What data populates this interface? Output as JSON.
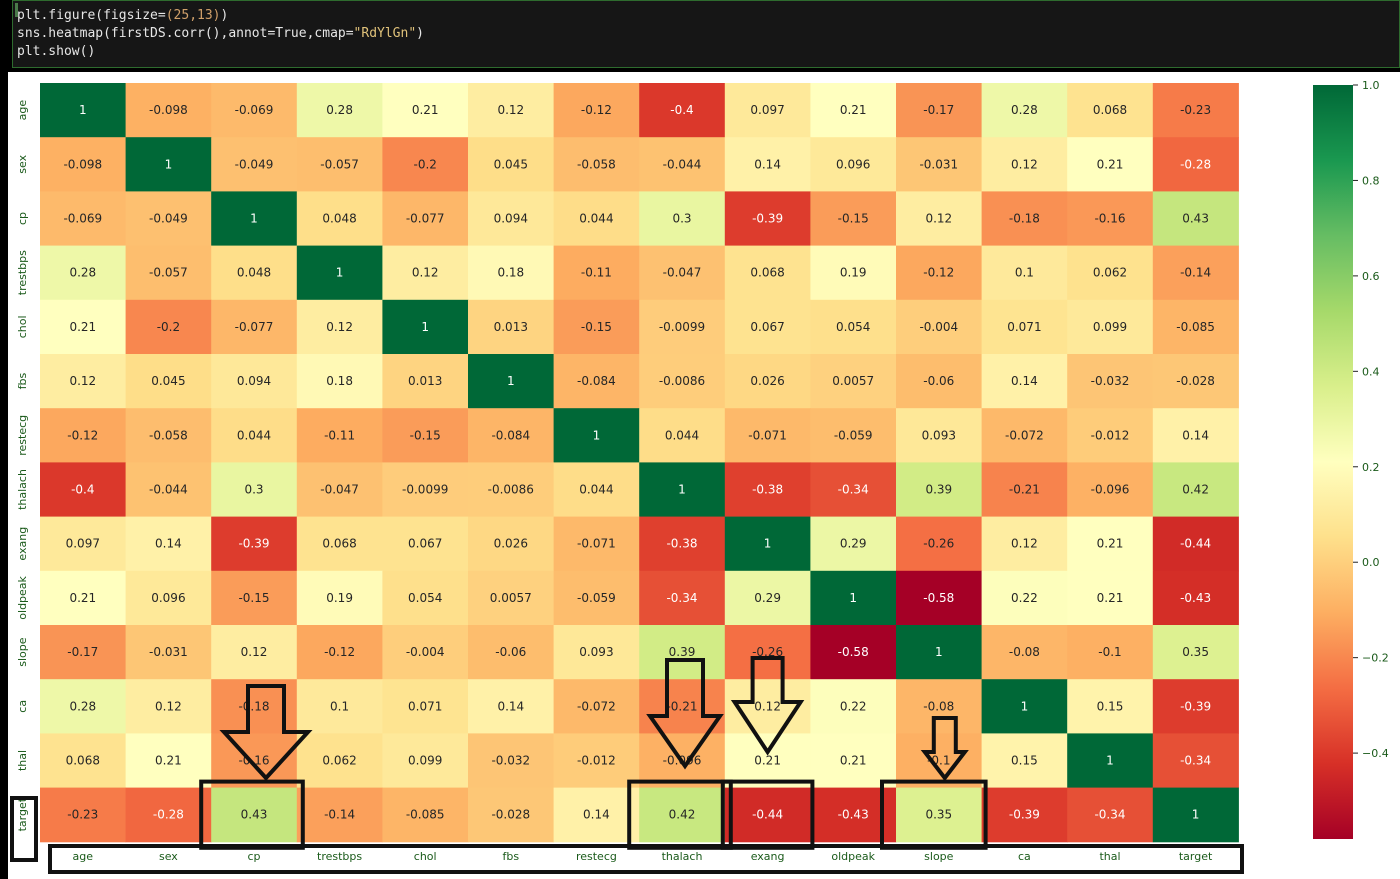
{
  "code": {
    "line1_pre": "plt.figure(figsize=",
    "line1_lit": "(25,13)",
    "line1_post": ")",
    "line2_pre": "sns.heatmap(firstDS.corr(),annot=True,cmap=",
    "line2_str": "\"RdYlGn\"",
    "line2_post": ")",
    "line3": "plt.show()"
  },
  "chart_data": {
    "type": "heatmap",
    "colormap": "RdYlGn",
    "vmin": -0.58,
    "vmax": 1.0,
    "rows": [
      "age",
      "sex",
      "cp",
      "trestbps",
      "chol",
      "fbs",
      "restecg",
      "thalach",
      "exang",
      "oldpeak",
      "slope",
      "ca",
      "thal",
      "target"
    ],
    "cols": [
      "age",
      "sex",
      "cp",
      "trestbps",
      "chol",
      "fbs",
      "restecg",
      "thalach",
      "exang",
      "oldpeak",
      "slope",
      "ca",
      "thal",
      "target"
    ],
    "values": [
      [
        1,
        -0.098,
        -0.069,
        0.28,
        0.21,
        0.12,
        -0.12,
        -0.4,
        0.097,
        0.21,
        -0.17,
        0.28,
        0.068,
        -0.23
      ],
      [
        -0.098,
        1,
        -0.049,
        -0.057,
        -0.2,
        0.045,
        -0.058,
        -0.044,
        0.14,
        0.096,
        -0.031,
        0.12,
        0.21,
        -0.28
      ],
      [
        -0.069,
        -0.049,
        1,
        0.048,
        -0.077,
        0.094,
        0.044,
        0.3,
        -0.39,
        -0.15,
        0.12,
        -0.18,
        -0.16,
        0.43
      ],
      [
        0.28,
        -0.057,
        0.048,
        1,
        0.12,
        0.18,
        -0.11,
        -0.047,
        0.068,
        0.19,
        -0.12,
        0.1,
        0.062,
        -0.14
      ],
      [
        0.21,
        -0.2,
        -0.077,
        0.12,
        1,
        0.013,
        -0.15,
        -0.0099,
        0.067,
        0.054,
        -0.004,
        0.071,
        0.099,
        -0.085
      ],
      [
        0.12,
        0.045,
        0.094,
        0.18,
        0.013,
        1,
        -0.084,
        -0.0086,
        0.026,
        0.0057,
        -0.06,
        0.14,
        -0.032,
        -0.028
      ],
      [
        -0.12,
        -0.058,
        0.044,
        -0.11,
        -0.15,
        -0.084,
        1,
        0.044,
        -0.071,
        -0.059,
        0.093,
        -0.072,
        -0.012,
        0.14
      ],
      [
        -0.4,
        -0.044,
        0.3,
        -0.047,
        -0.0099,
        -0.0086,
        0.044,
        1,
        -0.38,
        -0.34,
        0.39,
        -0.21,
        -0.096,
        0.42
      ],
      [
        0.097,
        0.14,
        -0.39,
        0.068,
        0.067,
        0.026,
        -0.071,
        -0.38,
        1,
        0.29,
        -0.26,
        0.12,
        0.21,
        -0.44
      ],
      [
        0.21,
        0.096,
        -0.15,
        0.19,
        0.054,
        0.0057,
        -0.059,
        -0.34,
        0.29,
        1,
        -0.58,
        0.22,
        0.21,
        -0.43
      ],
      [
        -0.17,
        -0.031,
        0.12,
        -0.12,
        -0.004,
        -0.06,
        0.093,
        0.39,
        -0.26,
        -0.58,
        1,
        -0.08,
        -0.1,
        0.35
      ],
      [
        0.28,
        0.12,
        -0.18,
        0.1,
        0.071,
        0.14,
        -0.072,
        -0.21,
        0.12,
        0.22,
        -0.08,
        1,
        0.15,
        -0.39
      ],
      [
        0.068,
        0.21,
        -0.16,
        0.062,
        0.099,
        -0.032,
        -0.012,
        -0.096,
        0.21,
        0.21,
        -0.1,
        0.15,
        1,
        -0.34
      ],
      [
        -0.23,
        -0.28,
        0.43,
        -0.14,
        -0.085,
        -0.028,
        0.14,
        0.42,
        -0.44,
        -0.43,
        0.35,
        -0.39,
        -0.34,
        1
      ]
    ],
    "colorbar_ticks": [
      1.0,
      0.8,
      0.6,
      0.4,
      0.2,
      0.0,
      -0.2,
      -0.4
    ],
    "annotations": {
      "highlighted_target_cols": [
        "cp",
        "thalach",
        "exang",
        "slope"
      ],
      "highlighted_row_label": "target",
      "highlighted_col_label_strip": true,
      "arrows_at_cols": [
        "cp",
        "thalach",
        "exang",
        "slope"
      ]
    }
  },
  "colors": {
    "annotation_box": "#111111",
    "code_bg": "#161616",
    "code_border": "#2e6b2e"
  }
}
